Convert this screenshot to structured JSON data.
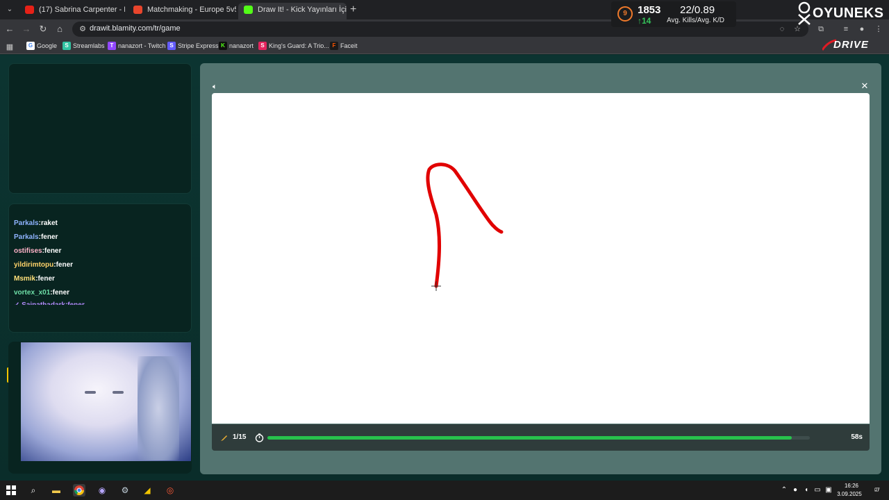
{
  "browser": {
    "tabs": [
      {
        "title": "(17) Sabrina Carpenter - M...",
        "favicon_color": "#e62117",
        "active": false
      },
      {
        "title": "Matchmaking - Europe 5v5 Qu...",
        "favicon_color": "#e8452c",
        "active": false
      },
      {
        "title": "Draw It! - Kick Yayınları İçin Çiz...",
        "favicon_color": "#53fc18",
        "active": true
      }
    ],
    "new_tab_label": "+",
    "url": "drawit.blamity.com/tr/game",
    "bookmarks": [
      {
        "label": "Google",
        "icon": "G",
        "color": "#ffffff"
      },
      {
        "label": "Streamlabs",
        "icon": "S",
        "color": "#31c3a2"
      },
      {
        "label": "nanazort - Twitch",
        "icon": "T",
        "color": "#9146ff"
      },
      {
        "label": "Stripe Express",
        "icon": "S",
        "color": "#635bff"
      },
      {
        "label": "nanazort",
        "icon": "K",
        "color": "#53fc18"
      },
      {
        "label": "King's Guard: A Trio...",
        "icon": "S",
        "color": "#e5245e"
      },
      {
        "label": "Faceit",
        "icon": "F",
        "color": "#ff5500"
      }
    ]
  },
  "stats": {
    "level": "9",
    "elo": "1853",
    "elo_change": "↑14",
    "kills_kd": "22/0.89",
    "kills_kd_label": "Avg. Kills/Avg. K/D"
  },
  "logos": {
    "oyuneks": "OYUNEKS",
    "drive": "DRIVE"
  },
  "chat": [
    {
      "user": "Parkals",
      "message": "raket",
      "color": "#8fb3ff"
    },
    {
      "user": "Parkals",
      "message": "fener",
      "color": "#8fb3ff"
    },
    {
      "user": "ostifises",
      "message": "fener",
      "color": "#ffb3c8"
    },
    {
      "user": "yildirimtopu",
      "message": "fener",
      "color": "#ffd36a"
    },
    {
      "user": "Msmik",
      "message": "fener",
      "color": "#ffe07a"
    },
    {
      "user": "vortex_x01",
      "message": "fener",
      "color": "#6fe0a8"
    }
  ],
  "game": {
    "round": "1/15",
    "time_left": "58s",
    "progress": 0.9667,
    "stroke_color": "#e10000"
  },
  "taskbar": {
    "time": "16:26",
    "date": "3.09.2025",
    "notifications": "27"
  }
}
